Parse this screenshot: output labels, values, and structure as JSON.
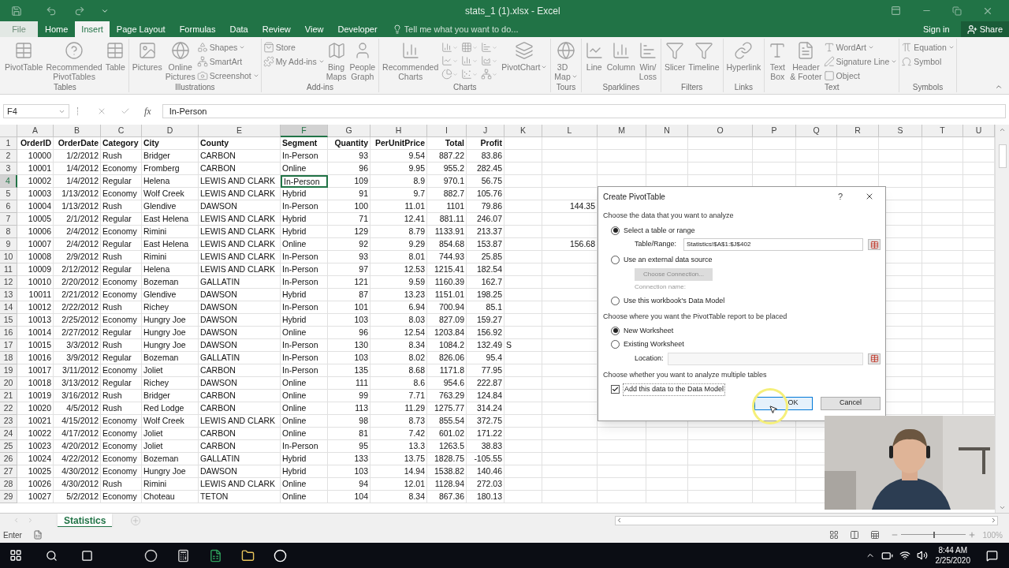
{
  "window": {
    "title": "stats_1 (1).xlsx - Excel"
  },
  "ribbon_tabs": [
    {
      "label": "File",
      "selected": false,
      "kind": "file"
    },
    {
      "label": "Home",
      "selected": false
    },
    {
      "label": "Insert",
      "selected": true
    },
    {
      "label": "Page Layout",
      "selected": false
    },
    {
      "label": "Formulas",
      "selected": false
    },
    {
      "label": "Data",
      "selected": false
    },
    {
      "label": "Review",
      "selected": false
    },
    {
      "label": "View",
      "selected": false
    },
    {
      "label": "Developer",
      "selected": false
    }
  ],
  "tell_me": {
    "placeholder": "Tell me what you want to do..."
  },
  "account": {
    "sign_in": "Sign in",
    "share": "Share"
  },
  "ribbon_groups": [
    {
      "label": "Tables",
      "items": [
        {
          "kind": "large",
          "label": "PivotTable"
        },
        {
          "kind": "large",
          "label": "Recommended\nPivotTables"
        },
        {
          "kind": "large",
          "label": "Table"
        }
      ]
    },
    {
      "label": "Illustrations",
      "items": [
        {
          "kind": "large",
          "label": "Pictures"
        },
        {
          "kind": "large",
          "label": "Online\nPictures"
        },
        {
          "kind": "stack",
          "items": [
            {
              "label": "Shapes",
              "dropdown": true
            },
            {
              "label": "SmartArt",
              "dropdown": false
            },
            {
              "label": "Screenshot",
              "dropdown": true
            }
          ]
        }
      ]
    },
    {
      "label": "Add-ins",
      "items": [
        {
          "kind": "stack",
          "items": [
            {
              "label": "Store",
              "dropdown": false
            },
            {
              "label": "My Add-ins",
              "dropdown": true
            }
          ]
        },
        {
          "kind": "large",
          "label": "Bing\nMaps"
        },
        {
          "kind": "large",
          "label": "People\nGraph"
        }
      ]
    },
    {
      "label": "Charts",
      "items": [
        {
          "kind": "large",
          "label": "Recommended\nCharts"
        },
        {
          "kind": "gallery"
        },
        {
          "kind": "large",
          "label": "PivotChart",
          "dropdown": true
        }
      ]
    },
    {
      "label": "Tours",
      "items": [
        {
          "kind": "large",
          "label": "3D\nMap",
          "dropdown": true
        }
      ]
    },
    {
      "label": "Sparklines",
      "items": [
        {
          "kind": "large",
          "label": "Line"
        },
        {
          "kind": "large",
          "label": "Column"
        },
        {
          "kind": "large",
          "label": "Win/\nLoss"
        }
      ]
    },
    {
      "label": "Filters",
      "items": [
        {
          "kind": "large",
          "label": "Slicer"
        },
        {
          "kind": "large",
          "label": "Timeline"
        }
      ]
    },
    {
      "label": "Links",
      "items": [
        {
          "kind": "large",
          "label": "Hyperlink"
        }
      ]
    },
    {
      "label": "Text",
      "items": [
        {
          "kind": "large",
          "label": "Text\nBox"
        },
        {
          "kind": "large",
          "label": "Header\n& Footer"
        },
        {
          "kind": "stack",
          "items": [
            {
              "label": "WordArt",
              "dropdown": true
            },
            {
              "label": "Signature Line",
              "dropdown": true
            },
            {
              "label": "Object",
              "dropdown": false
            }
          ]
        }
      ]
    },
    {
      "label": "Symbols",
      "items": [
        {
          "kind": "stack",
          "items": [
            {
              "label": "Equation",
              "dropdown": true
            },
            {
              "label": "Symbol",
              "dropdown": false
            }
          ]
        }
      ]
    }
  ],
  "formula_bar": {
    "name_box": "F4",
    "fx": "fx",
    "value": "In-Person"
  },
  "columns": [
    {
      "label": "A",
      "selected": false
    },
    {
      "label": "B",
      "selected": false
    },
    {
      "label": "C",
      "selected": false
    },
    {
      "label": "D",
      "selected": false
    },
    {
      "label": "E",
      "selected": false
    },
    {
      "label": "F",
      "selected": true
    },
    {
      "label": "G",
      "selected": false
    },
    {
      "label": "H",
      "selected": false
    },
    {
      "label": "I",
      "selected": false
    },
    {
      "label": "J",
      "selected": false
    },
    {
      "label": "K",
      "selected": false
    },
    {
      "label": "L",
      "selected": false
    },
    {
      "label": "M",
      "selected": false
    },
    {
      "label": "N",
      "selected": false
    },
    {
      "label": "O",
      "selected": false
    },
    {
      "label": "P",
      "selected": false
    },
    {
      "label": "Q",
      "selected": false
    },
    {
      "label": "R",
      "selected": false
    },
    {
      "label": "S",
      "selected": false
    },
    {
      "label": "T",
      "selected": false
    },
    {
      "label": "U",
      "selected": false
    }
  ],
  "rows": [
    {
      "number": "1",
      "selected": false,
      "header": true,
      "cells": [
        "OrderID",
        "OrderDate",
        "Category",
        "City",
        "County",
        "Segment",
        "Quantity",
        "PerUnitPrice",
        "Total",
        "Profit"
      ]
    },
    {
      "number": "2",
      "selected": false,
      "cells": [
        "10000",
        "1/2/2012",
        "Rush",
        "Bridger",
        "CARBON",
        "In-Person",
        "93",
        "9.54",
        "887.22",
        "83.86"
      ]
    },
    {
      "number": "3",
      "selected": false,
      "cells": [
        "10001",
        "1/4/2012",
        "Economy",
        "Fromberg",
        "CARBON",
        "Online",
        "96",
        "9.95",
        "955.2",
        "282.45"
      ]
    },
    {
      "number": "4",
      "selected": true,
      "cells": [
        "10002",
        "1/4/2012",
        "Regular",
        "Helena",
        "LEWIS AND CLARK",
        "In-Person",
        "109",
        "8.9",
        "970.1",
        "56.75"
      ]
    },
    {
      "number": "5",
      "selected": false,
      "cells": [
        "10003",
        "1/13/2012",
        "Economy",
        "Wolf Creek",
        "LEWIS AND CLARK",
        "Hybrid",
        "91",
        "9.7",
        "882.7",
        "105.76"
      ]
    },
    {
      "number": "6",
      "selected": false,
      "cells": [
        "10004",
        "1/13/2012",
        "Rush",
        "Glendive",
        "DAWSON",
        "In-Person",
        "100",
        "11.01",
        "1101",
        "79.86",
        null,
        "144.35"
      ]
    },
    {
      "number": "7",
      "selected": false,
      "cells": [
        "10005",
        "2/1/2012",
        "Regular",
        "East Helena",
        "LEWIS AND CLARK",
        "Hybrid",
        "71",
        "12.41",
        "881.11",
        "246.07"
      ]
    },
    {
      "number": "8",
      "selected": false,
      "cells": [
        "10006",
        "2/4/2012",
        "Economy",
        "Rimini",
        "LEWIS AND CLARK",
        "Hybrid",
        "129",
        "8.79",
        "1133.91",
        "213.37"
      ]
    },
    {
      "number": "9",
      "selected": false,
      "cells": [
        "10007",
        "2/4/2012",
        "Regular",
        "East Helena",
        "LEWIS AND CLARK",
        "Online",
        "92",
        "9.29",
        "854.68",
        "153.87",
        null,
        "156.68"
      ]
    },
    {
      "number": "10",
      "selected": false,
      "cells": [
        "10008",
        "2/9/2012",
        "Rush",
        "Rimini",
        "LEWIS AND CLARK",
        "In-Person",
        "93",
        "8.01",
        "744.93",
        "25.85"
      ]
    },
    {
      "number": "11",
      "selected": false,
      "cells": [
        "10009",
        "2/12/2012",
        "Regular",
        "Helena",
        "LEWIS AND CLARK",
        "In-Person",
        "97",
        "12.53",
        "1215.41",
        "182.54"
      ]
    },
    {
      "number": "12",
      "selected": false,
      "cells": [
        "10010",
        "2/20/2012",
        "Economy",
        "Bozeman",
        "GALLATIN",
        "In-Person",
        "121",
        "9.59",
        "1160.39",
        "162.7"
      ]
    },
    {
      "number": "13",
      "selected": false,
      "cells": [
        "10011",
        "2/21/2012",
        "Economy",
        "Glendive",
        "DAWSON",
        "Hybrid",
        "87",
        "13.23",
        "1151.01",
        "198.25"
      ]
    },
    {
      "number": "14",
      "selected": false,
      "cells": [
        "10012",
        "2/22/2012",
        "Rush",
        "Richey",
        "DAWSON",
        "In-Person",
        "101",
        "6.94",
        "700.94",
        "85.1"
      ]
    },
    {
      "number": "15",
      "selected": false,
      "cells": [
        "10013",
        "2/25/2012",
        "Economy",
        "Hungry Joe",
        "DAWSON",
        "Hybrid",
        "103",
        "8.03",
        "827.09",
        "159.27"
      ]
    },
    {
      "number": "16",
      "selected": false,
      "cells": [
        "10014",
        "2/27/2012",
        "Regular",
        "Hungry Joe",
        "DAWSON",
        "Online",
        "96",
        "12.54",
        "1203.84",
        "156.92"
      ]
    },
    {
      "number": "17",
      "selected": false,
      "cells": [
        "10015",
        "3/3/2012",
        "Rush",
        "Hungry Joe",
        "DAWSON",
        "In-Person",
        "130",
        "8.34",
        "1084.2",
        "132.49",
        "S"
      ]
    },
    {
      "number": "18",
      "selected": false,
      "cells": [
        "10016",
        "3/9/2012",
        "Regular",
        "Bozeman",
        "GALLATIN",
        "In-Person",
        "103",
        "8.02",
        "826.06",
        "95.4"
      ]
    },
    {
      "number": "19",
      "selected": false,
      "cells": [
        "10017",
        "3/11/2012",
        "Economy",
        "Joliet",
        "CARBON",
        "In-Person",
        "135",
        "8.68",
        "1171.8",
        "77.95"
      ]
    },
    {
      "number": "20",
      "selected": false,
      "cells": [
        "10018",
        "3/13/2012",
        "Regular",
        "Richey",
        "DAWSON",
        "Online",
        "111",
        "8.6",
        "954.6",
        "222.87"
      ]
    },
    {
      "number": "21",
      "selected": false,
      "cells": [
        "10019",
        "3/16/2012",
        "Rush",
        "Bridger",
        "CARBON",
        "Online",
        "99",
        "7.71",
        "763.29",
        "124.84"
      ]
    },
    {
      "number": "22",
      "selected": false,
      "cells": [
        "10020",
        "4/5/2012",
        "Rush",
        "Red Lodge",
        "CARBON",
        "Online",
        "113",
        "11.29",
        "1275.77",
        "314.24"
      ]
    },
    {
      "number": "23",
      "selected": false,
      "cells": [
        "10021",
        "4/15/2012",
        "Economy",
        "Wolf Creek",
        "LEWIS AND CLARK",
        "Online",
        "98",
        "8.73",
        "855.54",
        "372.75"
      ]
    },
    {
      "number": "24",
      "selected": false,
      "cells": [
        "10022",
        "4/17/2012",
        "Economy",
        "Joliet",
        "CARBON",
        "Online",
        "81",
        "7.42",
        "601.02",
        "171.22"
      ]
    },
    {
      "number": "25",
      "selected": false,
      "cells": [
        "10023",
        "4/20/2012",
        "Economy",
        "Joliet",
        "CARBON",
        "In-Person",
        "95",
        "13.3",
        "1263.5",
        "38.83"
      ]
    },
    {
      "number": "26",
      "selected": false,
      "cells": [
        "10024",
        "4/22/2012",
        "Economy",
        "Bozeman",
        "GALLATIN",
        "Hybrid",
        "133",
        "13.75",
        "1828.75",
        "-105.55"
      ]
    },
    {
      "number": "27",
      "selected": false,
      "cells": [
        "10025",
        "4/30/2012",
        "Economy",
        "Hungry Joe",
        "DAWSON",
        "Hybrid",
        "103",
        "14.94",
        "1538.82",
        "140.46"
      ]
    },
    {
      "number": "28",
      "selected": false,
      "cells": [
        "10026",
        "4/30/2012",
        "Rush",
        "Rimini",
        "LEWIS AND CLARK",
        "Online",
        "94",
        "12.01",
        "1128.94",
        "272.03"
      ]
    },
    {
      "number": "29",
      "selected": false,
      "cells": [
        "10027",
        "5/2/2012",
        "Economy",
        "Choteau",
        "TETON",
        "Online",
        "104",
        "8.34",
        "867.36",
        "180.13"
      ]
    }
  ],
  "sheet_tabs": [
    {
      "label": "Statistics",
      "selected": true
    }
  ],
  "status_bar": {
    "mode": "Enter",
    "zoom": "100%",
    "zoom_slider": {
      "level": 0.5
    }
  },
  "dialog": {
    "title": "Create PivotTable",
    "help": "?",
    "source_heading": "Choose the data that you want to analyze",
    "source_options": [
      {
        "label": "Select a table or range",
        "selected": true,
        "kind": "range"
      },
      {
        "label": "Use an external data source",
        "selected": false,
        "kind": "external"
      },
      {
        "label": "Use this workbook's Data Model",
        "selected": false,
        "kind": "model"
      }
    ],
    "range_field": {
      "label": "Table/Range:",
      "value": "Statistics!$A$1:$J$402"
    },
    "connection_button": {
      "label": "Choose Connection...",
      "disabled": true
    },
    "connection_name": "Connection name:",
    "placement_heading": "Choose where you want the PivotTable report to be placed",
    "placement_options": [
      {
        "label": "New Worksheet",
        "selected": true
      },
      {
        "label": "Existing Worksheet",
        "selected": false
      }
    ],
    "location_field": {
      "label": "Location:"
    },
    "multiple_heading": "Choose whether you want to analyze multiple tables",
    "data_model_checkbox": {
      "label": "Add this data to the Data Model",
      "checked": true
    },
    "buttons": [
      {
        "label": "OK",
        "kind": "primary"
      },
      {
        "label": "Cancel",
        "kind": "secondary"
      }
    ]
  },
  "taskbar": {
    "time": "8:44 AM",
    "date": "2/25/2020"
  }
}
